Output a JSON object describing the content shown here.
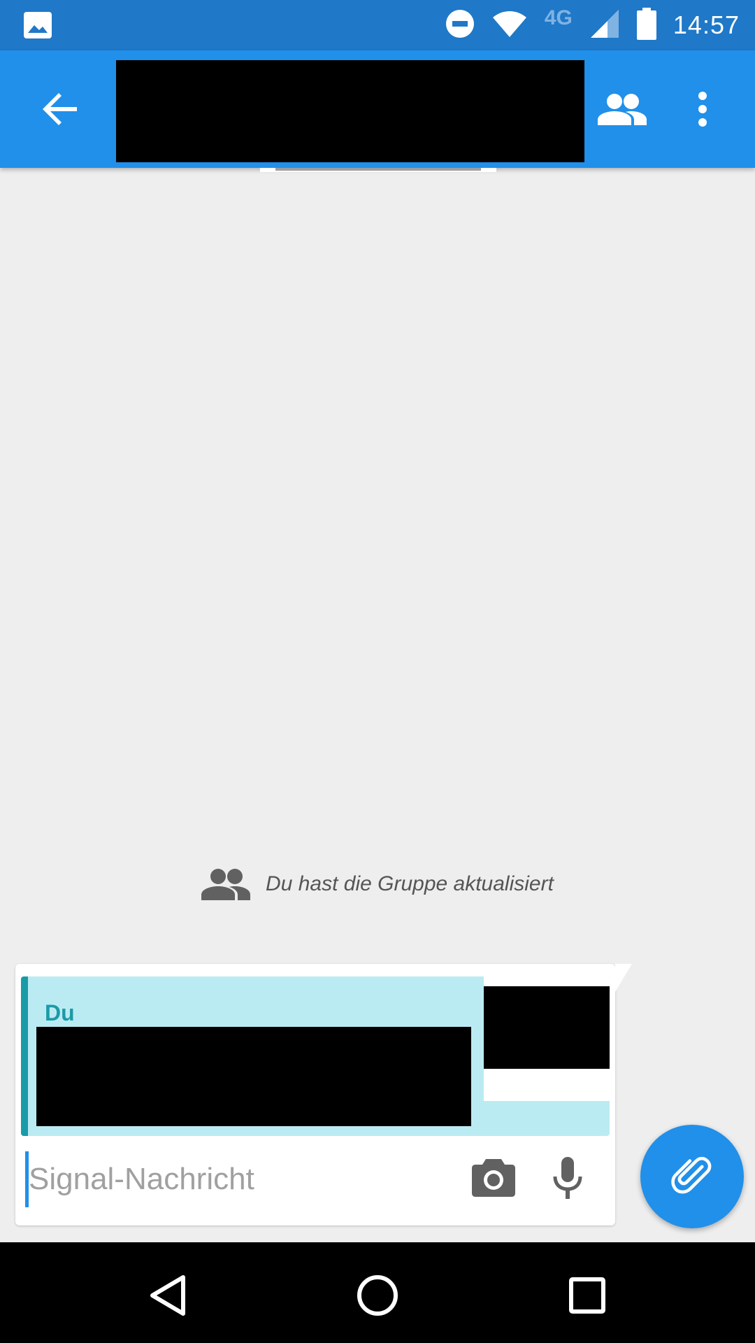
{
  "status_bar": {
    "network_label": "4G",
    "time": "14:57"
  },
  "app_bar": {
    "title": ""
  },
  "conversation": {
    "group_update_text": "Du hast die Gruppe aktualisiert"
  },
  "composer": {
    "quote_author": "Du",
    "input_value": "",
    "input_placeholder": "Signal-Nachricht"
  },
  "colors": {
    "status_bar": "#1f78c8",
    "app_bar": "#2090ea",
    "quote_bg": "#bbebf2",
    "quote_accent": "#1a9ba8",
    "background": "#eeeeee"
  },
  "icons": {
    "status": [
      "image-icon",
      "do-not-disturb-icon",
      "wifi-icon",
      "cell-signal-icon",
      "battery-icon"
    ],
    "app_bar": [
      "arrow-back-icon",
      "group-icon",
      "more-vert-icon"
    ],
    "composer": [
      "camera-icon",
      "mic-icon",
      "attach-icon"
    ],
    "nav": [
      "nav-back-icon",
      "nav-home-icon",
      "nav-recents-icon"
    ]
  }
}
